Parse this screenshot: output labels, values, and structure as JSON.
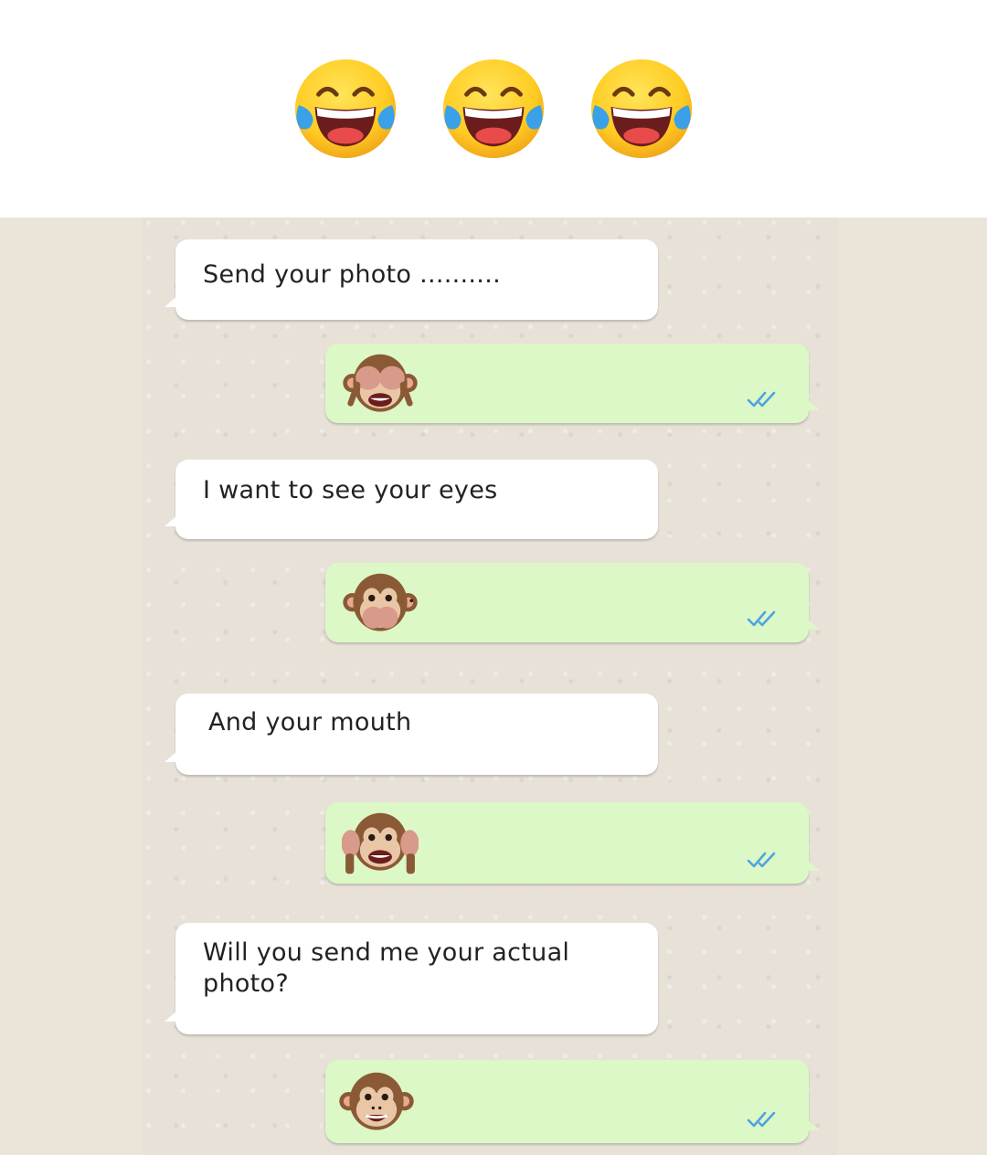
{
  "header": {
    "emojis": [
      "face-with-tears-of-joy-icon",
      "face-with-tears-of-joy-icon",
      "face-with-tears-of-joy-icon"
    ]
  },
  "colors": {
    "incoming_bubble": "#ffffff",
    "outgoing_bubble": "#dcf8c6",
    "read_ticks": "#4fa3e0",
    "chat_background": "#e7e1d8"
  },
  "messages": [
    {
      "direction": "incoming",
      "text": "Send your photo .........."
    },
    {
      "direction": "outgoing",
      "emoji": "see-no-evil-monkey-icon",
      "status": "read"
    },
    {
      "direction": "incoming",
      "text": "I want to see your eyes"
    },
    {
      "direction": "outgoing",
      "emoji": "speak-no-evil-monkey-icon",
      "status": "read"
    },
    {
      "direction": "incoming",
      "text": "And your mouth"
    },
    {
      "direction": "outgoing",
      "emoji": "hear-no-evil-monkey-icon",
      "status": "read"
    },
    {
      "direction": "incoming",
      "text": "Will you send me your actual photo?"
    },
    {
      "direction": "outgoing",
      "emoji": "monkey-face-icon",
      "status": "read"
    }
  ]
}
